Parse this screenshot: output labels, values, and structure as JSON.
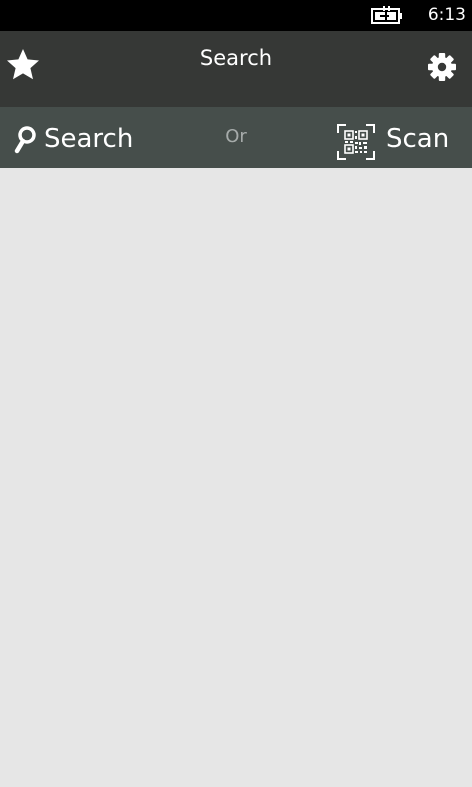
{
  "status_bar": {
    "time": "6:13",
    "battery_icon": "battery-charging-icon"
  },
  "header": {
    "title": "Search",
    "left_icon": "star-icon",
    "right_icon": "gear-icon"
  },
  "action_bar": {
    "search_label": "Search",
    "search_icon": "magnifier-icon",
    "separator_label": "Or",
    "scan_label": "Scan",
    "scan_icon": "qr-code-icon"
  },
  "colors": {
    "status_bar_bg": "#000000",
    "header_bg": "#363836",
    "action_bar_bg": "#464e4b",
    "content_bg": "#e6e6e6",
    "separator_text": "#a6abaa",
    "text_primary": "#ffffff"
  }
}
